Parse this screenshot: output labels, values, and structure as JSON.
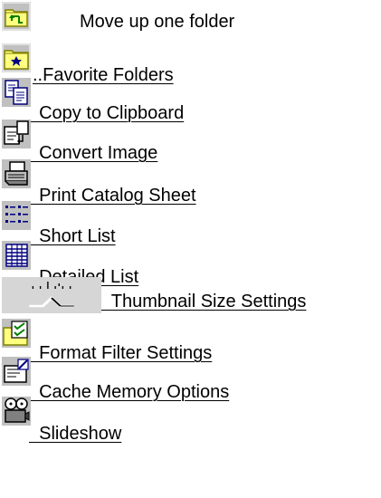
{
  "items": [
    {
      "label": "Move up one folder",
      "icon": "folder-up-icon",
      "link": false
    },
    {
      "label": "..Favorite Folders",
      "icon": "favorite-folder-icon",
      "link": true
    },
    {
      "label": "  Copy to Clipboard",
      "icon": "copy-clipboard-icon",
      "link": true
    },
    {
      "label": "  Convert Image",
      "icon": "convert-image-icon",
      "link": true
    },
    {
      "label": "  Print Catalog Sheet",
      "icon": "printer-icon",
      "link": true
    },
    {
      "label": "  Short List",
      "icon": "short-list-icon",
      "link": true
    },
    {
      "label": "  Detailed List",
      "icon": "detailed-list-icon",
      "link": true
    },
    {
      "label": "  Thumbnail Size Settings",
      "icon": "thumbnail-size-slider-icon",
      "link": true
    },
    {
      "label": "  Format Filter Settings",
      "icon": "format-filter-icon",
      "link": true
    },
    {
      "label": "  Cache Memory Options",
      "icon": "cache-memory-icon",
      "link": true
    },
    {
      "label": "  Slideshow",
      "icon": "slideshow-icon",
      "link": true
    }
  ],
  "colors": {
    "icon_bg": "#c0c0c0",
    "folder_yellow": "#ffff80",
    "folder_dark": "#808000",
    "icon_green": "#008000",
    "icon_blue": "#000080",
    "text": "#000000",
    "background": "#ffffff"
  }
}
